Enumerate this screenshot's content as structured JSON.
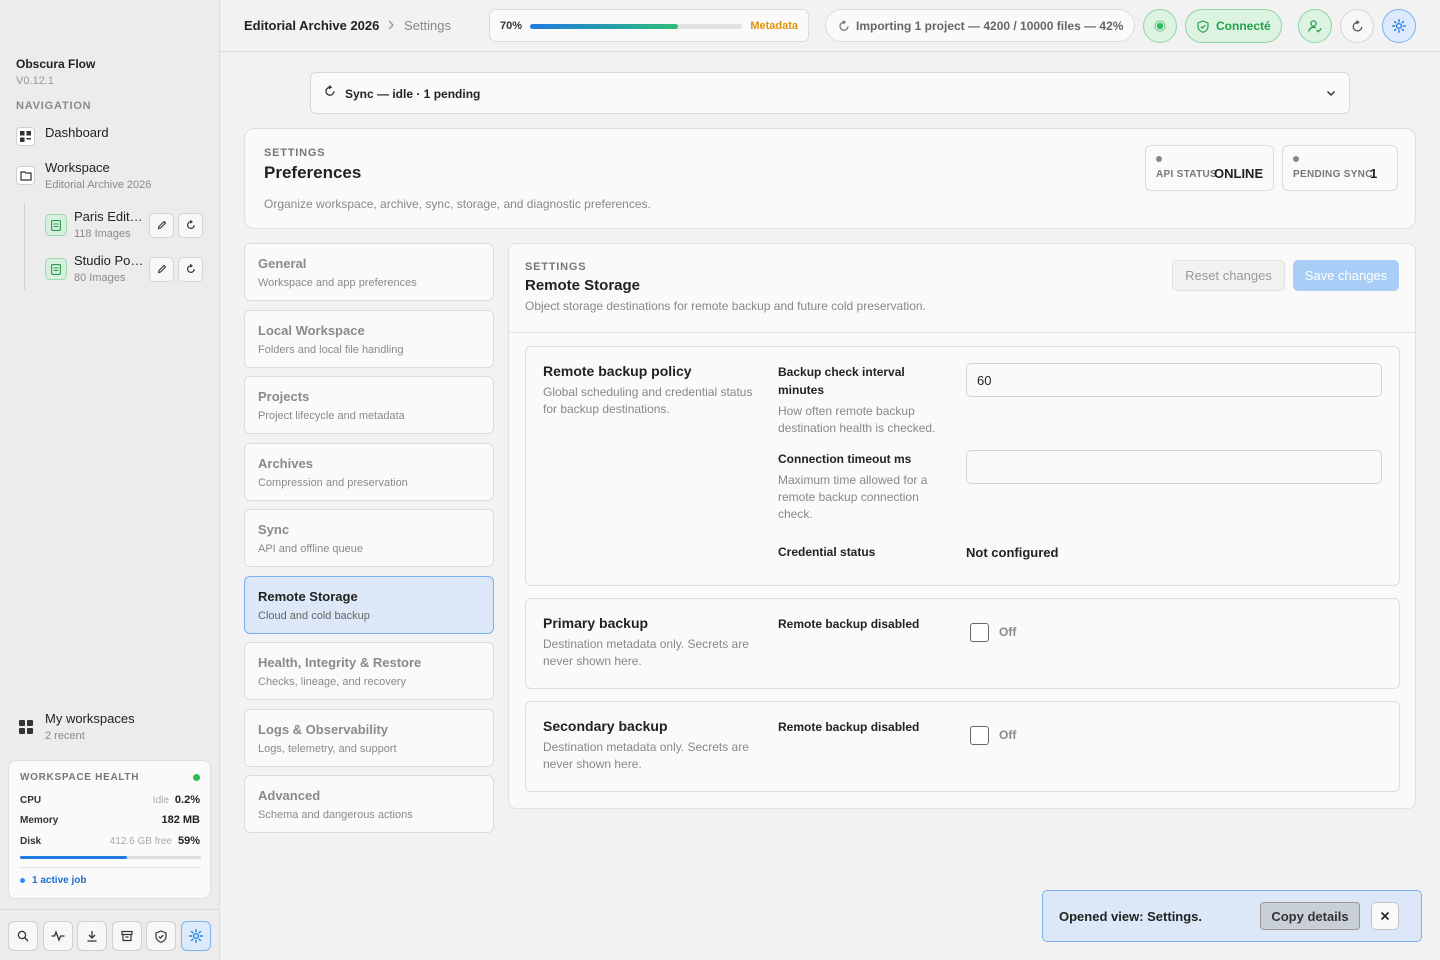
{
  "app": {
    "name": "Obscura Flow",
    "version": "V0.12.1"
  },
  "sidebar": {
    "nav_heading": "NAVIGATION",
    "dashboard": {
      "label": "Dashboard",
      "icon": "dashboard-icon"
    },
    "workspace": {
      "label": "Workspace",
      "sub": "Editorial Archive 2026",
      "icon": "folder-icon"
    },
    "projects": [
      {
        "name": "Paris Editorial",
        "count": "118 Images"
      },
      {
        "name": "Studio Portraits",
        "count": "80 Images"
      }
    ],
    "my_workspaces": {
      "label": "My workspaces",
      "sub": "2 recent"
    },
    "health": {
      "title": "WORKSPACE HEALTH",
      "status_color": "#2ebd59",
      "cpu": {
        "label": "CPU",
        "note": "Idle",
        "value": "0.2%"
      },
      "memory": {
        "label": "Memory",
        "value": "182 MB"
      },
      "disk": {
        "label": "Disk",
        "note": "412.6 GB free",
        "value": "59%",
        "fill_fraction": 0.59
      },
      "active_jobs": "1 active job"
    },
    "bottom_icons": [
      "search-icon",
      "activity-icon",
      "download-icon",
      "archive-icon",
      "shield-icon",
      "settings-icon"
    ]
  },
  "topbar": {
    "breadcrumb_root": "Editorial Archive 2026",
    "breadcrumb_current": "Settings",
    "progress": {
      "percent_label": "70%",
      "fraction": 0.7,
      "label": "Metadata"
    },
    "import_status": "Importing 1 project — 4200 / 10000 files — 42%",
    "connection_status": "Connecté"
  },
  "sync": {
    "text": "Sync — idle · 1 pending"
  },
  "preferences": {
    "eyebrow": "SETTINGS",
    "title": "Preferences",
    "description": "Organize workspace, archive, sync, storage, and diagnostic preferences.",
    "api_status_label": "API STATUS",
    "api_status_value": "ONLINE",
    "pending_sync_label": "PENDING SYNC",
    "pending_sync_value": "1"
  },
  "categories": [
    {
      "title": "General",
      "sub": "Workspace and app preferences"
    },
    {
      "title": "Local Workspace",
      "sub": "Folders and local file handling"
    },
    {
      "title": "Projects",
      "sub": "Project lifecycle and metadata"
    },
    {
      "title": "Archives",
      "sub": "Compression and preservation"
    },
    {
      "title": "Sync",
      "sub": "API and offline queue"
    },
    {
      "title": "Remote Storage",
      "sub": "Cloud and cold backup",
      "active": true
    },
    {
      "title": "Health, Integrity & Restore",
      "sub": "Checks, lineage, and recovery"
    },
    {
      "title": "Logs & Observability",
      "sub": "Logs, telemetry, and support"
    },
    {
      "title": "Advanced",
      "sub": "Schema and dangerous actions"
    }
  ],
  "panel": {
    "eyebrow": "SETTINGS",
    "title": "Remote Storage",
    "description": "Object storage destinations for remote backup and future cold preservation.",
    "reset_label": "Reset changes",
    "save_label": "Save changes",
    "policy": {
      "title": "Remote backup policy",
      "description": "Global scheduling and credential status for backup destinations.",
      "interval_label": "Backup check interval minutes",
      "interval_help": "How often remote backup destination health is checked.",
      "interval_value": "60",
      "timeout_label": "Connection timeout ms",
      "timeout_help": "Maximum time allowed for a remote backup connection check.",
      "timeout_value": "",
      "credential_label": "Credential status",
      "credential_value": "Not configured"
    },
    "primary": {
      "title": "Primary backup",
      "description": "Destination metadata only. Secrets are never shown here.",
      "field_label": "Remote backup disabled",
      "toggle_label": "Off"
    },
    "secondary": {
      "title": "Secondary backup",
      "description": "Destination metadata only. Secrets are never shown here.",
      "field_label": "Remote backup disabled",
      "toggle_label": "Off"
    }
  },
  "toast": {
    "message": "Opened view: Settings.",
    "copy_label": "Copy details"
  }
}
